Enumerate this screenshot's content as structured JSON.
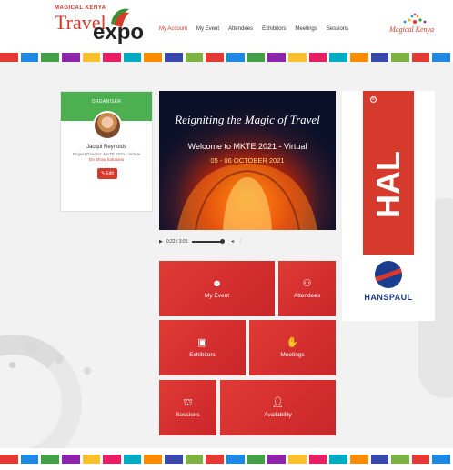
{
  "header": {
    "logo": {
      "small": "MAGICAL KENYA",
      "travel": "Travel",
      "expo": "expo"
    },
    "nav": [
      {
        "label": "My Account",
        "active": true
      },
      {
        "label": "My Event",
        "active": false
      },
      {
        "label": "Attendees",
        "active": false
      },
      {
        "label": "Exhibitors",
        "active": false
      },
      {
        "label": "Meetings",
        "active": false
      },
      {
        "label": "Sessions",
        "active": false
      }
    ],
    "brand": "Magical Kenya"
  },
  "stripe_colors": [
    "#e53935",
    "#1e88e5",
    "#43a047",
    "#8e24aa",
    "#fbc02d",
    "#e91e63",
    "#00acc1",
    "#fb8c00",
    "#3949ab",
    "#7cb342",
    "#e53935",
    "#1e88e5",
    "#43a047",
    "#8e24aa",
    "#fbc02d",
    "#e91e63",
    "#00acc1",
    "#fb8c00",
    "#3949ab",
    "#7cb342",
    "#e53935",
    "#1e88e5"
  ],
  "organiser": {
    "header": "ORGANISER",
    "name": "Jacqui Reynolds",
    "title": "Project Director: MKTE 2021 - Virtual",
    "company": "On Show Solutions",
    "edit_label": "Edit"
  },
  "video": {
    "script_title": "Reigniting the Magic of Travel",
    "welcome": "Welcome to MKTE 2021 - Virtual",
    "dates": "05 - 06 OCTOBER 2021"
  },
  "audio": {
    "time": "0:22 / 3:05"
  },
  "ad": {
    "brand": "HAL",
    "sponsor": "HANSPAUL"
  },
  "tiles": {
    "my_event": "My Event",
    "attendees": "Attendees",
    "exhibitors": "Exhibitors",
    "meetings": "Meetings",
    "sessions": "Sessions",
    "availability": "Availability"
  },
  "colors": {
    "accent": "#d63a2c",
    "organiser_header": "#4caf50",
    "tile": "#d9312e"
  }
}
